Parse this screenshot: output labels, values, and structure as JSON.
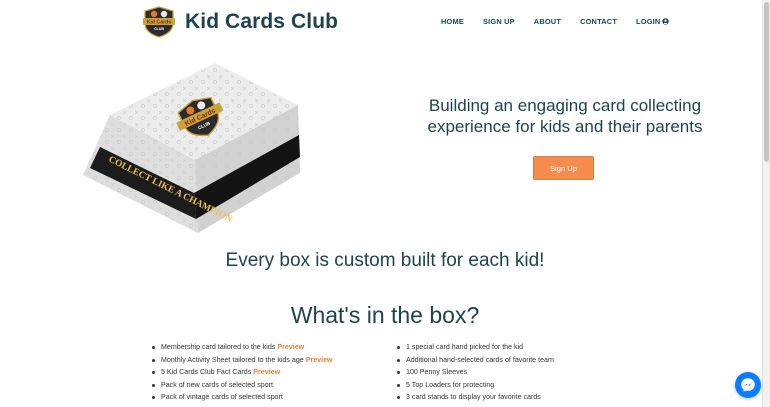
{
  "brand": {
    "name": "Kid Cards Club",
    "logo_text_top": "Kid Cards",
    "logo_text_bottom": "CLUB"
  },
  "nav": {
    "items": [
      "HOME",
      "SIGN UP",
      "ABOUT",
      "CONTACT",
      "LOGIN"
    ],
    "login_icon": "user-circle-icon"
  },
  "hero": {
    "title": "Building an engaging card collecting experience for kids and their parents",
    "signup_label": "Sign Up",
    "box_banner_text": "COLLECT LIKE A CHAMPION",
    "box_logo_top": "Kid Cards",
    "box_logo_bottom": "CLUB"
  },
  "tagline": "Every box is custom built for each kid!",
  "contents": {
    "title": "What's in the box?",
    "preview_label": "Preview",
    "left": [
      {
        "text": "Membership card tailored to the kids",
        "preview": true
      },
      {
        "text": "Monthly Activity Sheet tailored to the kids age",
        "preview": true
      },
      {
        "text": "5 Kid Cards Club Fact Cards",
        "preview": true
      },
      {
        "text": "Pack of new cards of selected sport",
        "preview": false
      },
      {
        "text": "Pack of vintage cards of selected sport",
        "preview": false
      }
    ],
    "right": [
      {
        "text": "1 special card hand picked for the kid"
      },
      {
        "text": "Additional hand-selected cards of favorite team"
      },
      {
        "text": "100 Penny Sleeves"
      },
      {
        "text": "5 Top Loaders for protecting"
      },
      {
        "text": "3 card stands to display your favorite cards"
      }
    ]
  },
  "colors": {
    "brand_dark": "#1e4350",
    "accent_orange": "#f58b4c",
    "preview_orange": "#f07f36",
    "messenger_blue": "#0a7cff"
  },
  "widgets": {
    "chat_icon": "messenger-icon"
  }
}
